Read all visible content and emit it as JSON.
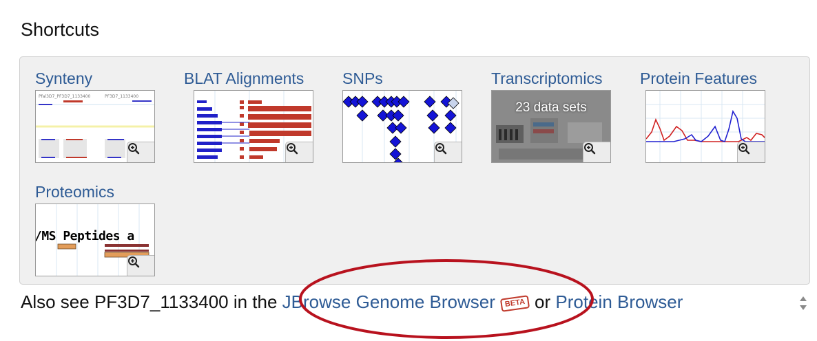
{
  "section": {
    "title": "Shortcuts"
  },
  "shortcuts": [
    {
      "label": "Synteny"
    },
    {
      "label": "BLAT Alignments"
    },
    {
      "label": "SNPs"
    },
    {
      "label": "Transcriptomics",
      "overlay_text": "23 data sets"
    },
    {
      "label": "Protein Features"
    },
    {
      "label": "Proteomics",
      "thumb_text": "/MS Peptides a"
    }
  ],
  "footer": {
    "prefix": "Also see PF3D7_1133400 in the ",
    "jbrowse_link": "JBrowse Genome Browser",
    "beta_badge": "BETA",
    "connector": "or",
    "protein_link": "Protein Browser"
  },
  "icons": {
    "zoom": "magnify-plus-icon",
    "spinner": "spin-arrows-icon"
  },
  "colors": {
    "link": "#2e5b95",
    "highlight_ellipse": "#b8121e",
    "panel_bg": "#f0f0f0"
  }
}
